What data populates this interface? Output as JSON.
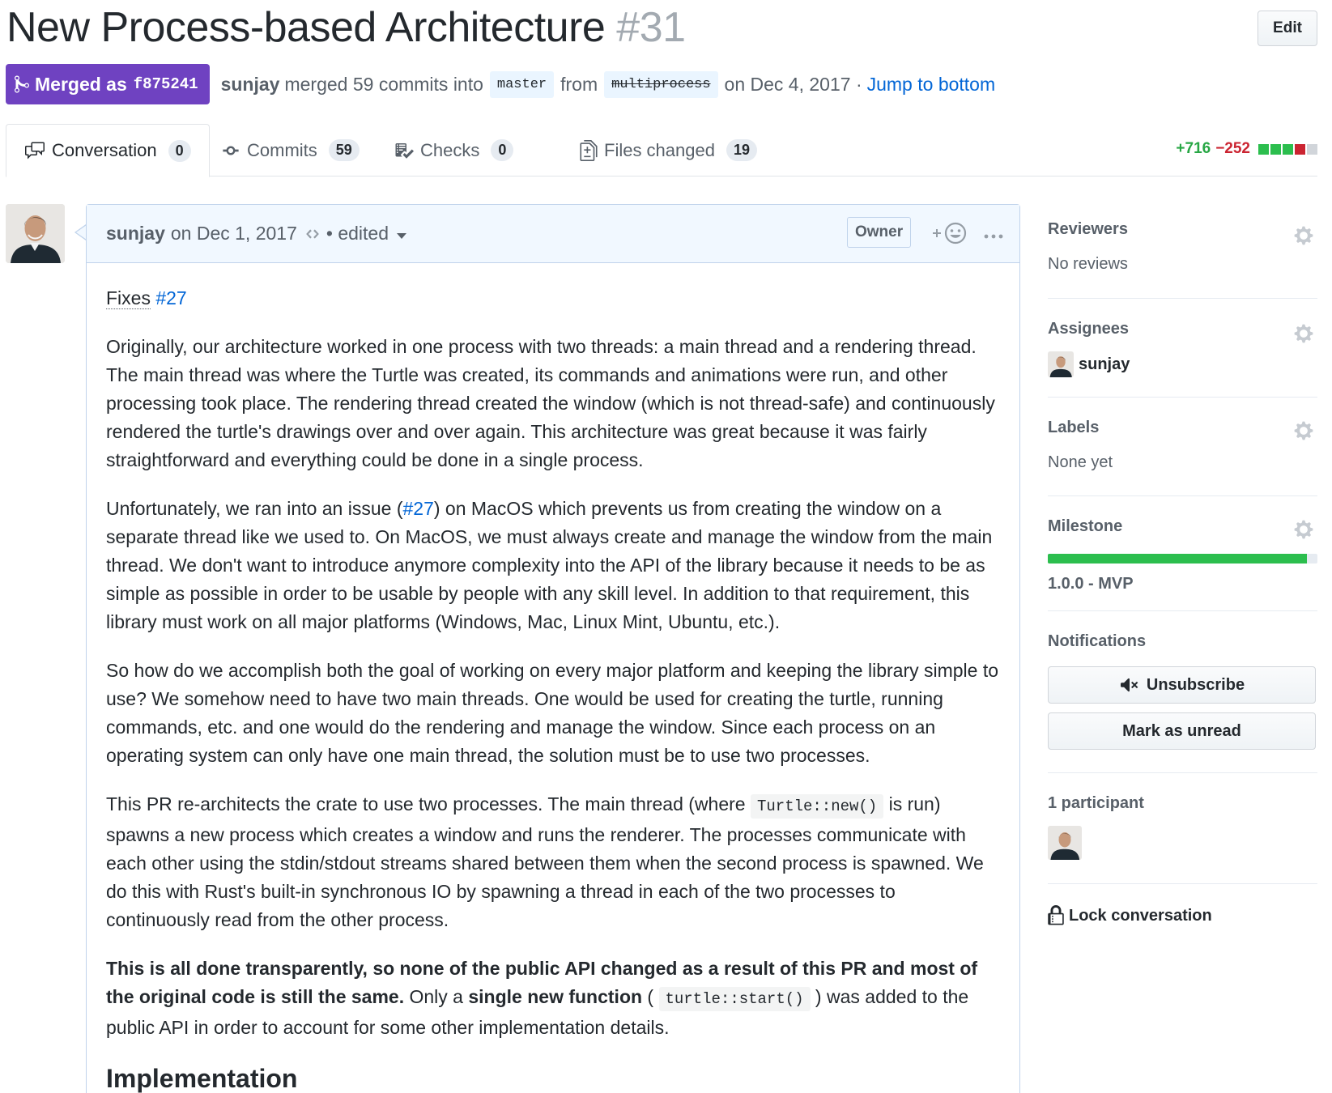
{
  "pr": {
    "title": "New Process-based Architecture",
    "number": "#31",
    "edit_label": "Edit"
  },
  "meta": {
    "status": "Merged as",
    "sha": "f875241",
    "author": "sunjay",
    "merged_text": "merged 59 commits into",
    "base_branch": "master",
    "from_text": "from",
    "head_branch": "multiprocess",
    "date_text": "on Dec 4, 2017 ·",
    "jump_link": "Jump to bottom"
  },
  "tabs": [
    {
      "label": "Conversation",
      "count": "0",
      "icon": "comment-discussion-icon"
    },
    {
      "label": "Commits",
      "count": "59",
      "icon": "git-commit-icon"
    },
    {
      "label": "Checks",
      "count": "0",
      "icon": "checklist-icon"
    },
    {
      "label": "Files changed",
      "count": "19",
      "icon": "file-diff-icon"
    }
  ],
  "diffstat": {
    "additions": "+716",
    "deletions": "−252",
    "colors": {
      "add": "#28a745",
      "del": "#cb2431",
      "neutral": "#d1d5da"
    }
  },
  "comment": {
    "author": "sunjay",
    "date": "on Dec 1, 2017",
    "edited": "• edited",
    "owner_label": "Owner",
    "fixes_label": "Fixes",
    "fixes_link": "#27",
    "p1": "Originally, our architecture worked in one process with two threads: a main thread and a rendering thread. The main thread was where the Turtle was created, its commands and animations were run, and other processing took place. The rendering thread created the window (which is not thread-safe) and continuously rendered the turtle's drawings over and over again. This architecture was great because it was fairly straightforward and everything could be done in a single process.",
    "p2_a": "Unfortunately, we ran into an issue (",
    "p2_link": "#27",
    "p2_b": ") on MacOS which prevents us from creating the window on a separate thread like we used to. On MacOS, we must always create and manage the window from the main thread. We don't want to introduce anymore complexity into the API of the library because it needs to be as simple as possible in order to be usable by people with any skill level. In addition to that requirement, this library must work on all major platforms (Windows, Mac, Linux Mint, Ubuntu, etc.).",
    "p3": "So how do we accomplish both the goal of working on every major platform and keeping the library simple to use? We somehow need to have two main threads. One would be used for creating the turtle, running commands, etc. and one would do the rendering and manage the window. Since each process on an operating system can only have one main thread, the solution must be to use two processes.",
    "p4_a": "This PR re-architects the crate to use two processes. The main thread (where",
    "p4_code": "Turtle::new()",
    "p4_b": "is run) spawns a new process which creates a window and runs the renderer. The processes communicate with each other using the stdin/stdout streams shared between them when the second process is spawned. We do this with Rust's built-in synchronous IO by spawning a thread in each of the two processes to continuously read from the other process.",
    "p5_bold": "This is all done transparently, so none of the public API changed as a result of this PR and most of the original code is still the same.",
    "p5_a": "Only a",
    "p5_bold2": "single new function",
    "p5_code": "turtle::start()",
    "p5_b": "was added to the public API in order to account for some other implementation details.",
    "heading": "Implementation"
  },
  "sidebar": {
    "reviewers_title": "Reviewers",
    "reviewers_value": "No reviews",
    "assignees_title": "Assignees",
    "assignee": "sunjay",
    "labels_title": "Labels",
    "labels_value": "None yet",
    "milestone_title": "Milestone",
    "milestone_progress": 0.96,
    "milestone_value": "1.0.0 - MVP",
    "notifications_title": "Notifications",
    "unsubscribe_label": "Unsubscribe",
    "mark_unread_label": "Mark as unread",
    "participants_title": "1 participant",
    "lock_label": "Lock conversation"
  }
}
